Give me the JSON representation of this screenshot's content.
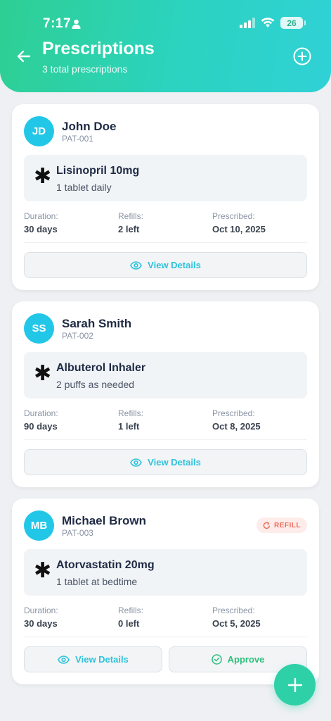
{
  "status_bar": {
    "time": "7:17",
    "battery": "26"
  },
  "header": {
    "title": "Prescriptions",
    "subtitle": "3 total prescriptions"
  },
  "labels": {
    "duration": "Duration:",
    "refills": "Refills:",
    "prescribed": "Prescribed:",
    "view_details": "View Details",
    "approve": "Approve",
    "refill_badge": "REFILL"
  },
  "prescriptions": [
    {
      "initials": "JD",
      "patient_name": "John Doe",
      "patient_id": "PAT-001",
      "medication": "Lisinopril 10mg",
      "dosage": "1 tablet daily",
      "duration": "30 days",
      "refills": "2 left",
      "prescribed": "Oct 10, 2025"
    },
    {
      "initials": "SS",
      "patient_name": "Sarah Smith",
      "patient_id": "PAT-002",
      "medication": "Albuterol Inhaler",
      "dosage": "2 puffs as needed",
      "duration": "90 days",
      "refills": "1 left",
      "prescribed": "Oct 8, 2025"
    },
    {
      "initials": "MB",
      "patient_name": "Michael Brown",
      "patient_id": "PAT-003",
      "medication": "Atorvastatin 20mg",
      "dosage": "1 tablet at bedtime",
      "duration": "30 days",
      "refills": "0 left",
      "prescribed": "Oct 5, 2025"
    }
  ],
  "colors": {
    "header_start": "#2ecf93",
    "header_end": "#30d1d6",
    "avatar": "#22c7e8",
    "view_link": "#2ec3dc",
    "approve": "#2fbf7e",
    "refill_badge": "#ef6b57"
  },
  "icons": {
    "back": "arrow-left-icon",
    "add": "plus-circle-icon",
    "medication": "asterisk-icon",
    "view": "eye-icon",
    "approve": "check-circle-icon",
    "refill": "refresh-icon",
    "fab": "plus-icon"
  }
}
